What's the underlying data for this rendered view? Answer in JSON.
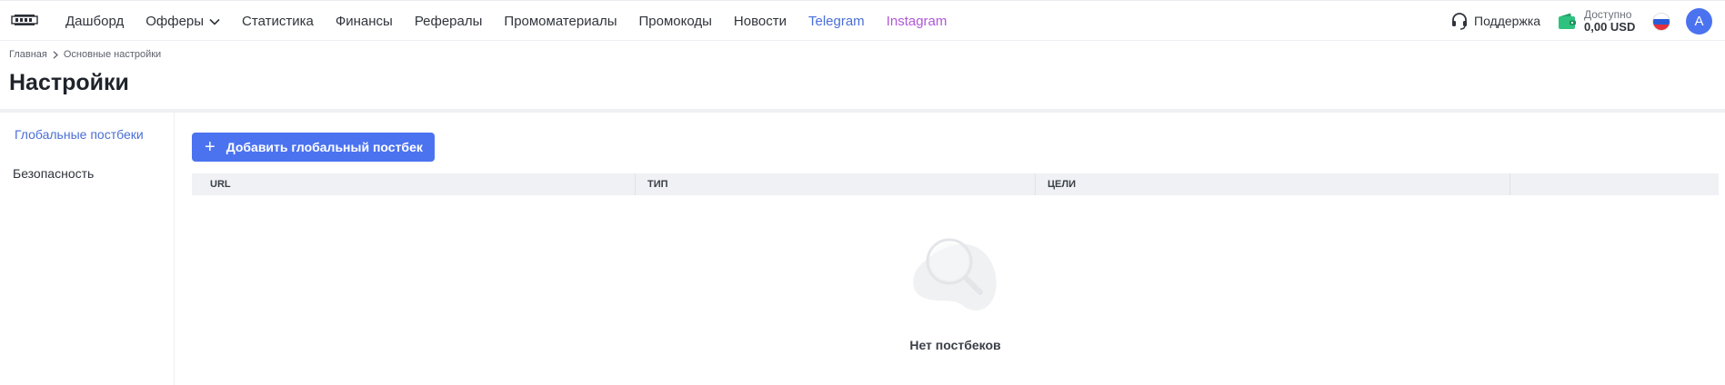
{
  "nav": {
    "items": [
      {
        "label": "Дашборд"
      },
      {
        "label": "Офферы"
      },
      {
        "label": "Статистика"
      },
      {
        "label": "Финансы"
      },
      {
        "label": "Рефералы"
      },
      {
        "label": "Промоматериалы"
      },
      {
        "label": "Промокоды"
      },
      {
        "label": "Новости"
      },
      {
        "label": "Telegram"
      },
      {
        "label": "Instagram"
      }
    ],
    "support_label": "Поддержка",
    "balance_label": "Доступно",
    "balance_value": "0,00 USD",
    "avatar_initial": "A",
    "link_colors": {
      "telegram": "#4a6fd6",
      "instagram": "#b157d8"
    }
  },
  "breadcrumb": {
    "home": "Главная",
    "current": "Основные настройки"
  },
  "page": {
    "title": "Настройки"
  },
  "sidebar": {
    "items": [
      {
        "label": "Глобальные постбеки",
        "active": true
      },
      {
        "label": "Безопасность",
        "active": false
      }
    ]
  },
  "main": {
    "add_button_label": "Добавить глобальный постбек",
    "table": {
      "columns": [
        "URL",
        "ТИП",
        "ЦЕЛИ",
        ""
      ]
    },
    "empty_text": "Нет постбеков"
  },
  "colors": {
    "accent": "#4b73f0",
    "active_link": "#4a6fd6"
  }
}
